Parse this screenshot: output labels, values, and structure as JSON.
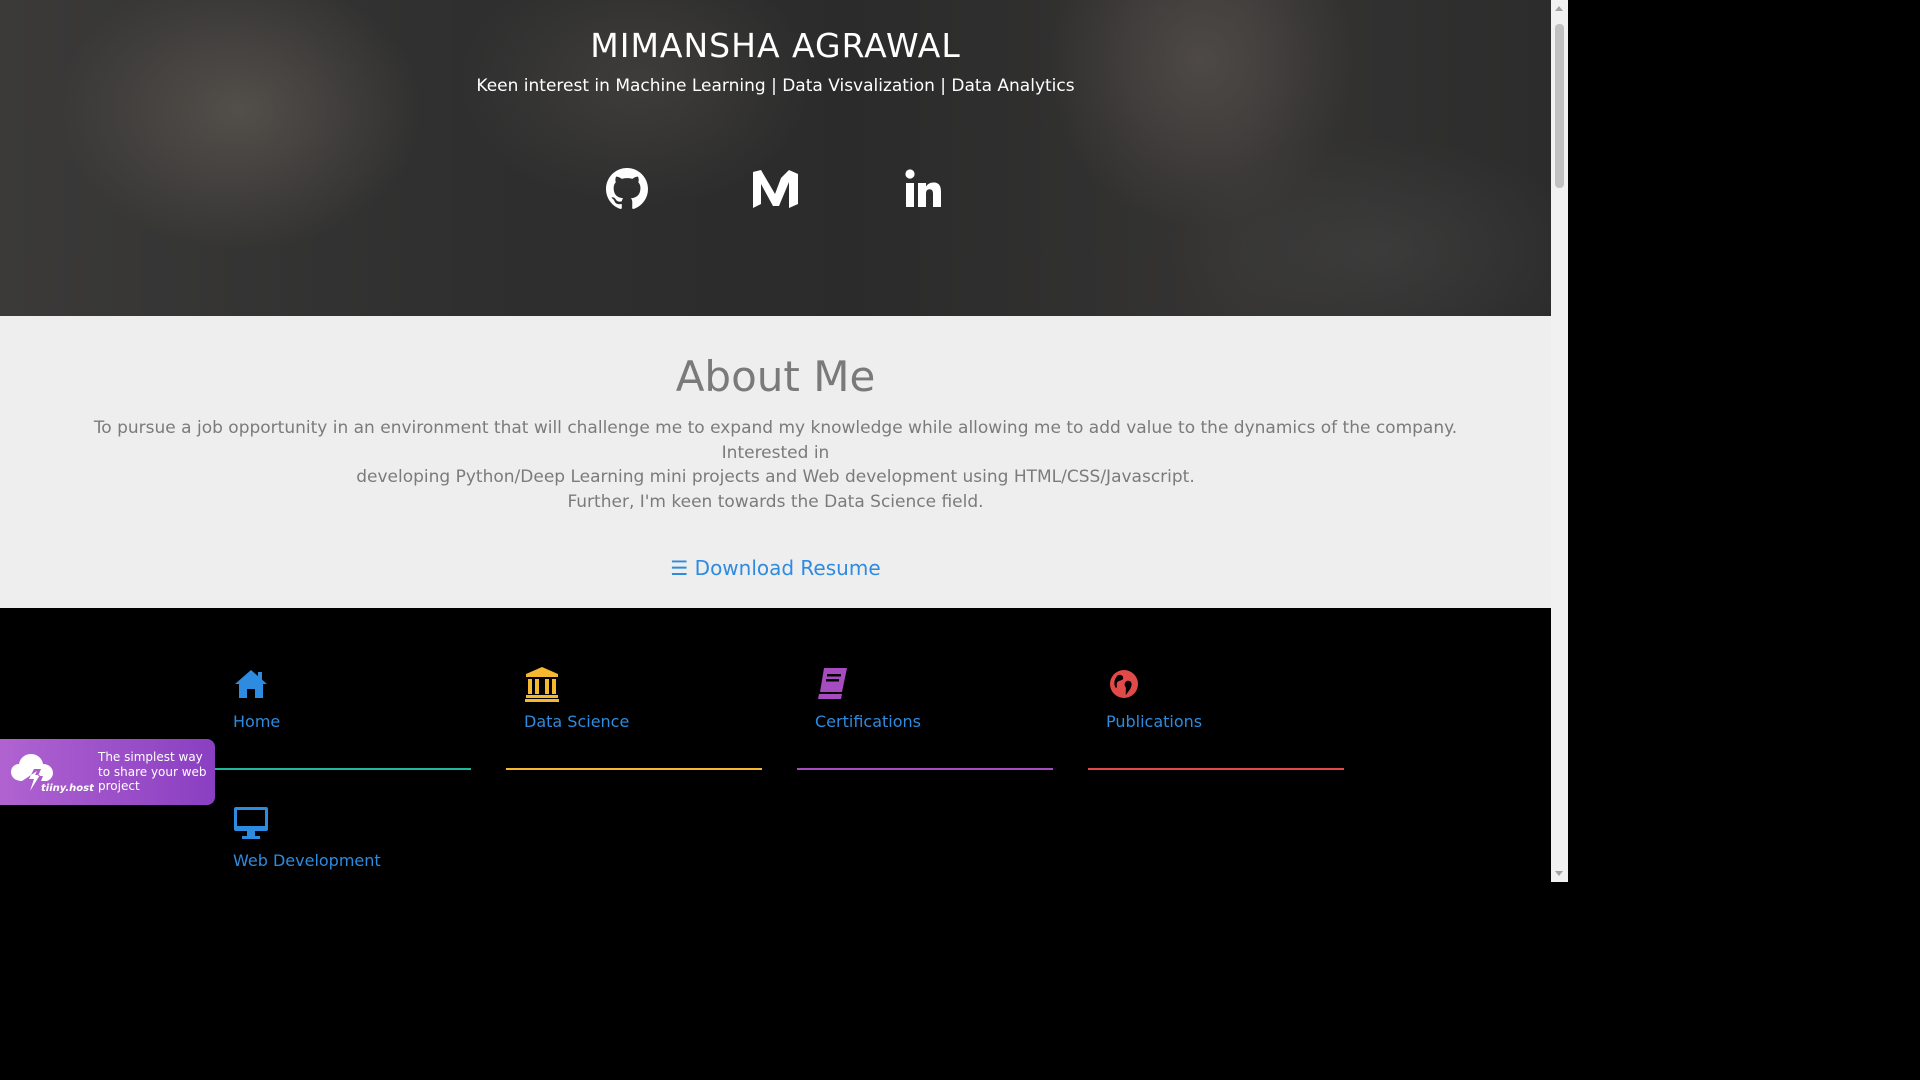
{
  "hero": {
    "name": "MIMANSHA AGRAWAL",
    "tagline": "Keen interest in Machine Learning | Data Visvalization | Data Analytics",
    "social": [
      {
        "icon": "github-icon"
      },
      {
        "icon": "medium-icon"
      },
      {
        "icon": "linkedin-icon"
      }
    ]
  },
  "about": {
    "title": "About Me",
    "line1": "To pursue a job opportunity in an environment that will challenge me to expand my knowledge while allowing me to add value to the dynamics of the company. Interested in",
    "line2": "developing Python/Deep Learning mini projects and Web development using HTML/CSS/Javascript.",
    "line3": "Further, I'm keen towards the Data Science field.",
    "download_label": "☰ Download Resume"
  },
  "nav": {
    "items": [
      {
        "label": "Home",
        "icon": "home-icon",
        "color": "#2d8be0",
        "line_color": "#1fb89a"
      },
      {
        "label": "Data Science",
        "icon": "bank-icon",
        "color": "#f5b82e",
        "line_color": "#f5b82e"
      },
      {
        "label": "Certifications",
        "icon": "book-icon",
        "color": "#a64bc0",
        "line_color": "#a64bc0"
      },
      {
        "label": "Publications",
        "icon": "globe-icon",
        "color": "#e24a4a",
        "line_color": "#e24a4a"
      },
      {
        "label": "Web Development",
        "icon": "desktop-icon",
        "color": "#2d8be0",
        "line_color": "#2d8be0"
      }
    ]
  },
  "badge": {
    "brand": "tiiny.host",
    "text": "The simplest way to share your web project"
  },
  "colors": {
    "link_blue": "#2d8be0",
    "about_bg": "#eeeeee",
    "nav_bg": "#000000"
  }
}
